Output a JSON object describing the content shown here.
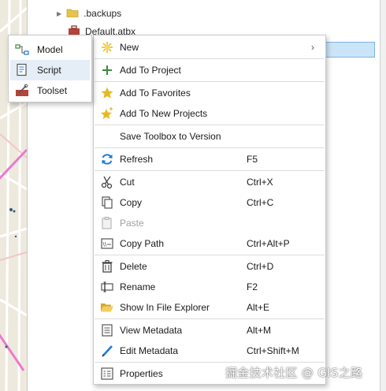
{
  "tree": {
    "items": [
      {
        "label": ".backups",
        "icon": "folder-icon"
      },
      {
        "label": "Default.atbx",
        "icon": "toolbox-icon"
      }
    ]
  },
  "submenu": {
    "items": [
      {
        "label": "Model",
        "icon": "model-icon"
      },
      {
        "label": "Script",
        "icon": "script-icon"
      },
      {
        "label": "Toolset",
        "icon": "toolset-icon"
      }
    ],
    "hover_index": 1
  },
  "menu": {
    "new": {
      "label": "New",
      "icon": "sparkle-icon"
    },
    "add_to_project": {
      "label": "Add To Project",
      "icon": "plus-icon"
    },
    "add_to_favorites": {
      "label": "Add To Favorites",
      "icon": "star-icon"
    },
    "add_to_new_projects": {
      "label": "Add To New Projects",
      "icon": "star-sparkle-icon"
    },
    "save_toolbox_to_version": {
      "label": "Save Toolbox to Version"
    },
    "refresh": {
      "label": "Refresh",
      "shortcut": "F5",
      "icon": "refresh-icon"
    },
    "cut": {
      "label": "Cut",
      "shortcut": "Ctrl+X",
      "icon": "scissors-icon"
    },
    "copy": {
      "label": "Copy",
      "shortcut": "Ctrl+C",
      "icon": "copy-icon"
    },
    "paste": {
      "label": "Paste",
      "icon": "paste-icon",
      "disabled": true
    },
    "copy_path": {
      "label": "Copy Path",
      "shortcut": "Ctrl+Alt+P",
      "icon": "copy-path-icon"
    },
    "delete": {
      "label": "Delete",
      "shortcut": "Ctrl+D",
      "icon": "trash-icon"
    },
    "rename": {
      "label": "Rename",
      "shortcut": "F2",
      "icon": "rename-icon"
    },
    "show_in_explorer": {
      "label": "Show In File Explorer",
      "shortcut": "Alt+E",
      "icon": "open-folder-icon"
    },
    "view_metadata": {
      "label": "View Metadata",
      "shortcut": "Alt+M",
      "icon": "document-icon"
    },
    "edit_metadata": {
      "label": "Edit Metadata",
      "shortcut": "Ctrl+Shift+M",
      "icon": "pencil-icon"
    },
    "properties": {
      "label": "Properties",
      "icon": "properties-icon"
    }
  },
  "watermark": "掘金技术社区 @ GIS之路",
  "colors": {
    "selection": "#cce4f7",
    "accent_blue": "#1e7bd4",
    "plus_green": "#3a8a3a",
    "star_gold": "#e8b820",
    "folder_yellow": "#e8c24a",
    "delete_dark": "#444444",
    "map_bg": "#eee9dd"
  }
}
